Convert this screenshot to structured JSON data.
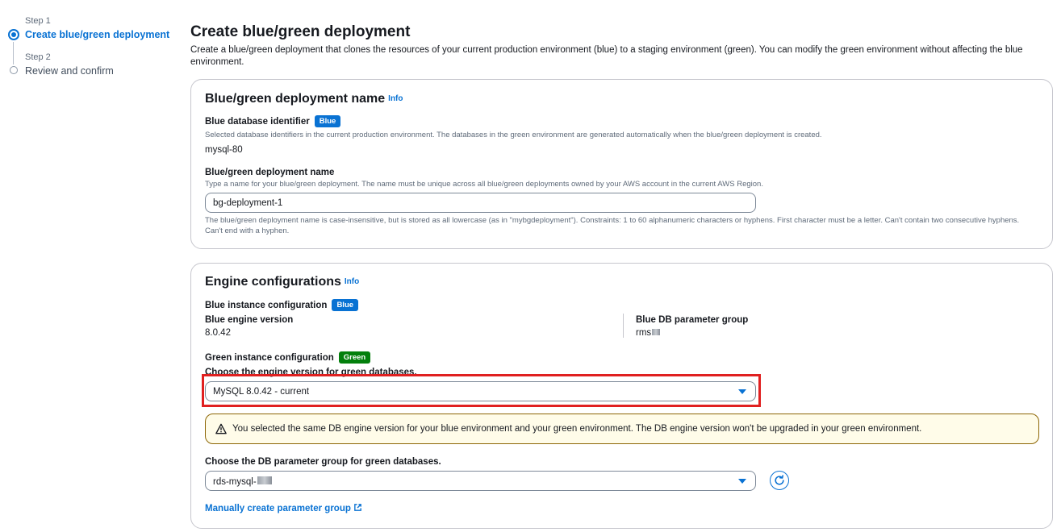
{
  "steps": [
    {
      "label": "Step 1",
      "title": "Create blue/green deployment"
    },
    {
      "label": "Step 2",
      "title": "Review and confirm"
    }
  ],
  "page": {
    "title": "Create blue/green deployment",
    "description": "Create a blue/green deployment that clones the resources of your current production environment (blue) to a staging environment (green). You can modify the green environment without affecting the blue environment."
  },
  "name_panel": {
    "title": "Blue/green deployment name",
    "info": "Info",
    "blue_db_label": "Blue database identifier",
    "blue_badge": "Blue",
    "blue_db_desc": "Selected database identifiers in the current production environment. The databases in the green environment are generated automatically when the blue/green deployment is created.",
    "blue_db_value": "mysql-80",
    "deploy_name_label": "Blue/green deployment name",
    "deploy_name_desc": "Type a name for your blue/green deployment. The name must be unique across all blue/green deployments owned by your AWS account in the current AWS Region.",
    "deploy_name_value": "bg-deployment-1",
    "deploy_name_constraints": "The blue/green deployment name is case-insensitive, but is stored as all lowercase (as in \"mybgdeployment\"). Constraints: 1 to 60 alphanumeric characters or hyphens. First character must be a letter. Can't contain two consecutive hyphens. Can't end with a hyphen."
  },
  "engine_panel": {
    "title": "Engine configurations",
    "info": "Info",
    "blue_instance_label": "Blue instance configuration",
    "blue_badge": "Blue",
    "blue_engine_label": "Blue engine version",
    "blue_engine_value": "8.0.42",
    "blue_param_label": "Blue DB parameter group",
    "blue_param_value": "rms",
    "green_instance_label": "Green instance configuration",
    "green_badge": "Green",
    "engine_select_label": "Choose the engine version for green databases.",
    "engine_select_value": "MySQL 8.0.42 - current",
    "alert_text": "You selected the same DB engine version for your blue environment and your green environment. The DB engine version won't be upgraded in your green environment.",
    "param_select_label": "Choose the DB parameter group for green databases.",
    "param_select_value": "rds-mysql-",
    "manual_link": "Manually create parameter group"
  },
  "colors": {
    "accent": "#0972d3",
    "green_badge": "#037f0c",
    "highlight": "#e02020",
    "warning_border": "#8d6605",
    "warning_bg": "#fffce9"
  }
}
